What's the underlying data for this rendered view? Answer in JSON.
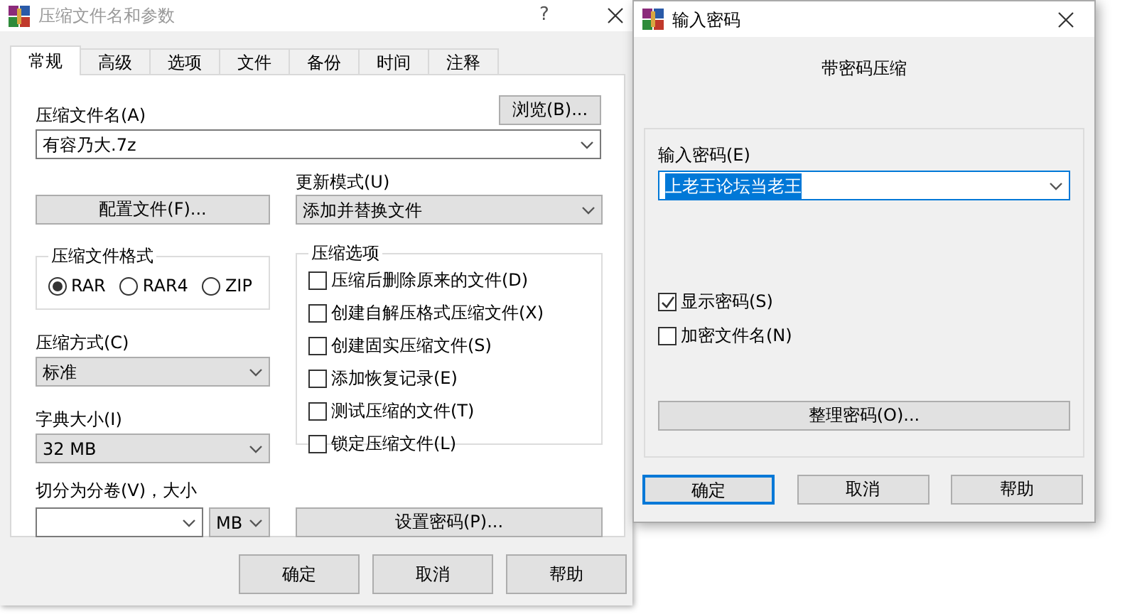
{
  "compress_dialog": {
    "title": "压缩文件名和参数",
    "active": false,
    "help": "?",
    "tabs": [
      {
        "label": "常规",
        "selected": true
      },
      {
        "label": "高级",
        "selected": false
      },
      {
        "label": "选项",
        "selected": false
      },
      {
        "label": "文件",
        "selected": false
      },
      {
        "label": "备份",
        "selected": false
      },
      {
        "label": "时间",
        "selected": false
      },
      {
        "label": "注释",
        "selected": false
      }
    ],
    "archive_name": {
      "label": "压缩文件名(A)",
      "value": "有容乃大.7z"
    },
    "browse_button": "浏览(B)...",
    "profiles_button": "配置文件(F)...",
    "update_mode": {
      "label": "更新模式(U)",
      "value": "添加并替换文件"
    },
    "format_group": {
      "title": "压缩文件格式",
      "options": [
        {
          "label": "RAR",
          "selected": true
        },
        {
          "label": "RAR4",
          "selected": false
        },
        {
          "label": "ZIP",
          "selected": false
        }
      ]
    },
    "method": {
      "label": "压缩方式(C)",
      "value": "标准"
    },
    "dictionary": {
      "label": "字典大小(I)",
      "value": "32 MB"
    },
    "split": {
      "label": "切分为分卷(V)，大小",
      "unit": "MB"
    },
    "options_group": {
      "title": "压缩选项",
      "options": [
        {
          "label": "压缩后删除原来的文件(D)",
          "checked": false
        },
        {
          "label": "创建自解压格式压缩文件(X)",
          "checked": false
        },
        {
          "label": "创建固实压缩文件(S)",
          "checked": false
        },
        {
          "label": "添加恢复记录(E)",
          "checked": false
        },
        {
          "label": "测试压缩的文件(T)",
          "checked": false
        },
        {
          "label": "锁定压缩文件(L)",
          "checked": false
        }
      ]
    },
    "password_button": "设置密码(P)...",
    "buttons": [
      {
        "label": "确定",
        "default": false
      },
      {
        "label": "取消",
        "default": false
      },
      {
        "label": "帮助",
        "default": false
      }
    ]
  },
  "password_dialog": {
    "title": "输入密码",
    "active": true,
    "heading": "带密码压缩",
    "password": {
      "label": "输入密码(E)",
      "value": "上老王论坛当老王"
    },
    "options": [
      {
        "label": "显示密码(S)",
        "checked": true
      },
      {
        "label": "加密文件名(N)",
        "checked": false
      }
    ],
    "organize_button": "整理密码(O)...",
    "buttons": [
      {
        "label": "确定",
        "default": true
      },
      {
        "label": "取消",
        "default": false
      },
      {
        "label": "帮助",
        "default": false
      }
    ]
  }
}
